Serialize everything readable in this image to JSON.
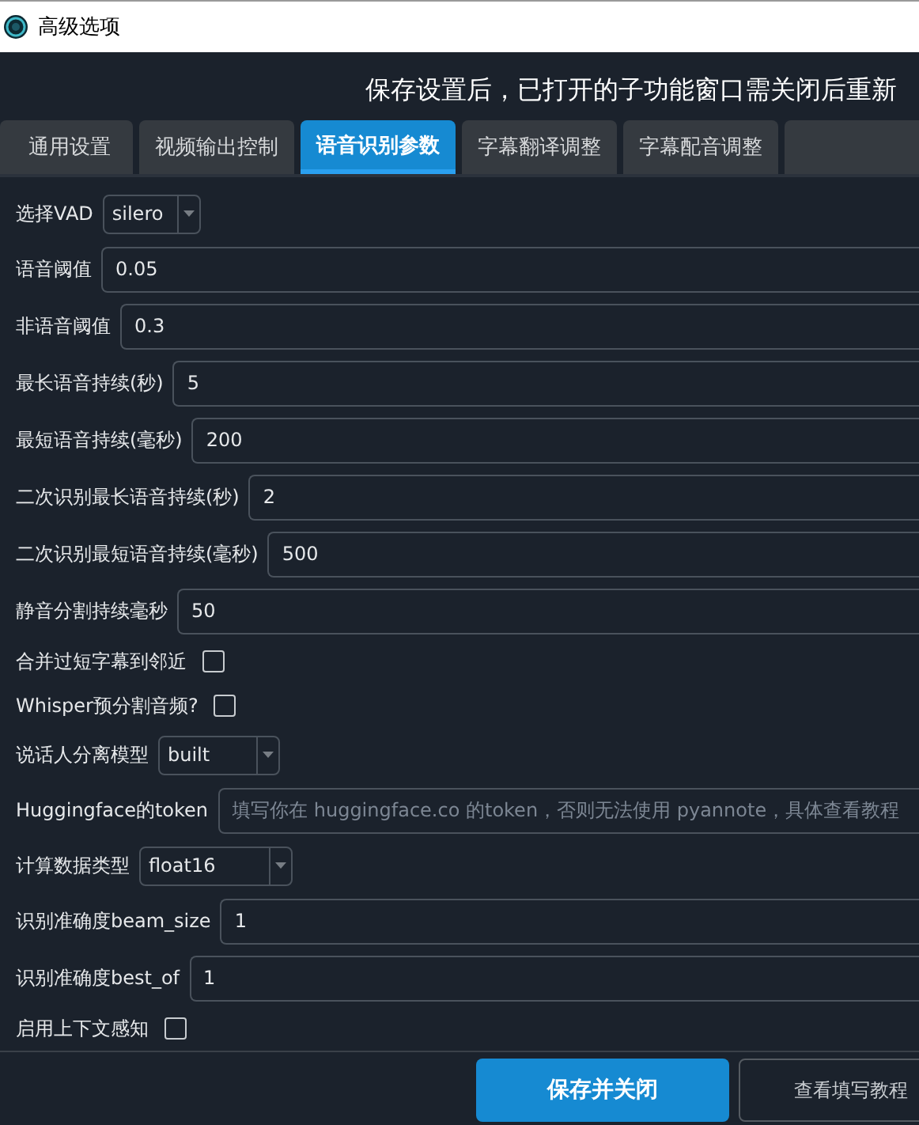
{
  "window": {
    "title": "高级选项"
  },
  "notice": "保存设置后，已打开的子功能窗口需关闭后重新",
  "tabs": [
    {
      "label": "通用设置",
      "selected": false
    },
    {
      "label": "视频输出控制",
      "selected": false
    },
    {
      "label": "语音识别参数",
      "selected": true
    },
    {
      "label": "字幕翻译调整",
      "selected": false
    },
    {
      "label": "字幕配音调整",
      "selected": false
    }
  ],
  "settings": [
    {
      "kind": "select",
      "label": "选择VAD",
      "value": "silero"
    },
    {
      "kind": "text",
      "label": "语音阈值",
      "value": "0.05"
    },
    {
      "kind": "text",
      "label": "非语音阈值",
      "value": "0.3"
    },
    {
      "kind": "text",
      "label": "最长语音持续(秒)",
      "value": "5"
    },
    {
      "kind": "text",
      "label": "最短语音持续(毫秒)",
      "value": "200"
    },
    {
      "kind": "text",
      "label": "二次识别最长语音持续(秒)",
      "value": "2"
    },
    {
      "kind": "text",
      "label": "二次识别最短语音持续(毫秒)",
      "value": "500"
    },
    {
      "kind": "text",
      "label": "静音分割持续毫秒",
      "value": "50"
    },
    {
      "kind": "checkbox",
      "label": "合并过短字幕到邻近",
      "checked": false
    },
    {
      "kind": "checkbox",
      "label": "Whisper预分割音频?",
      "checked": false
    },
    {
      "kind": "select",
      "label": "说话人分离模型",
      "value": "built"
    },
    {
      "kind": "text",
      "label": "Huggingface的token",
      "placeholder": "填写你在 huggingface.co 的token，否则无法使用 pyannote，具体查看教程"
    },
    {
      "kind": "select",
      "label": "计算数据类型",
      "value": "float16"
    },
    {
      "kind": "text",
      "label": "识别准确度beam_size",
      "value": "1"
    },
    {
      "kind": "text",
      "label": "识别准确度best_of",
      "value": "1"
    },
    {
      "kind": "checkbox",
      "label": "启用上下文感知",
      "checked": false
    }
  ],
  "buttons": [
    {
      "label": "保存并关闭",
      "primary": true
    },
    {
      "label": "查看填写教程",
      "primary": false
    }
  ]
}
